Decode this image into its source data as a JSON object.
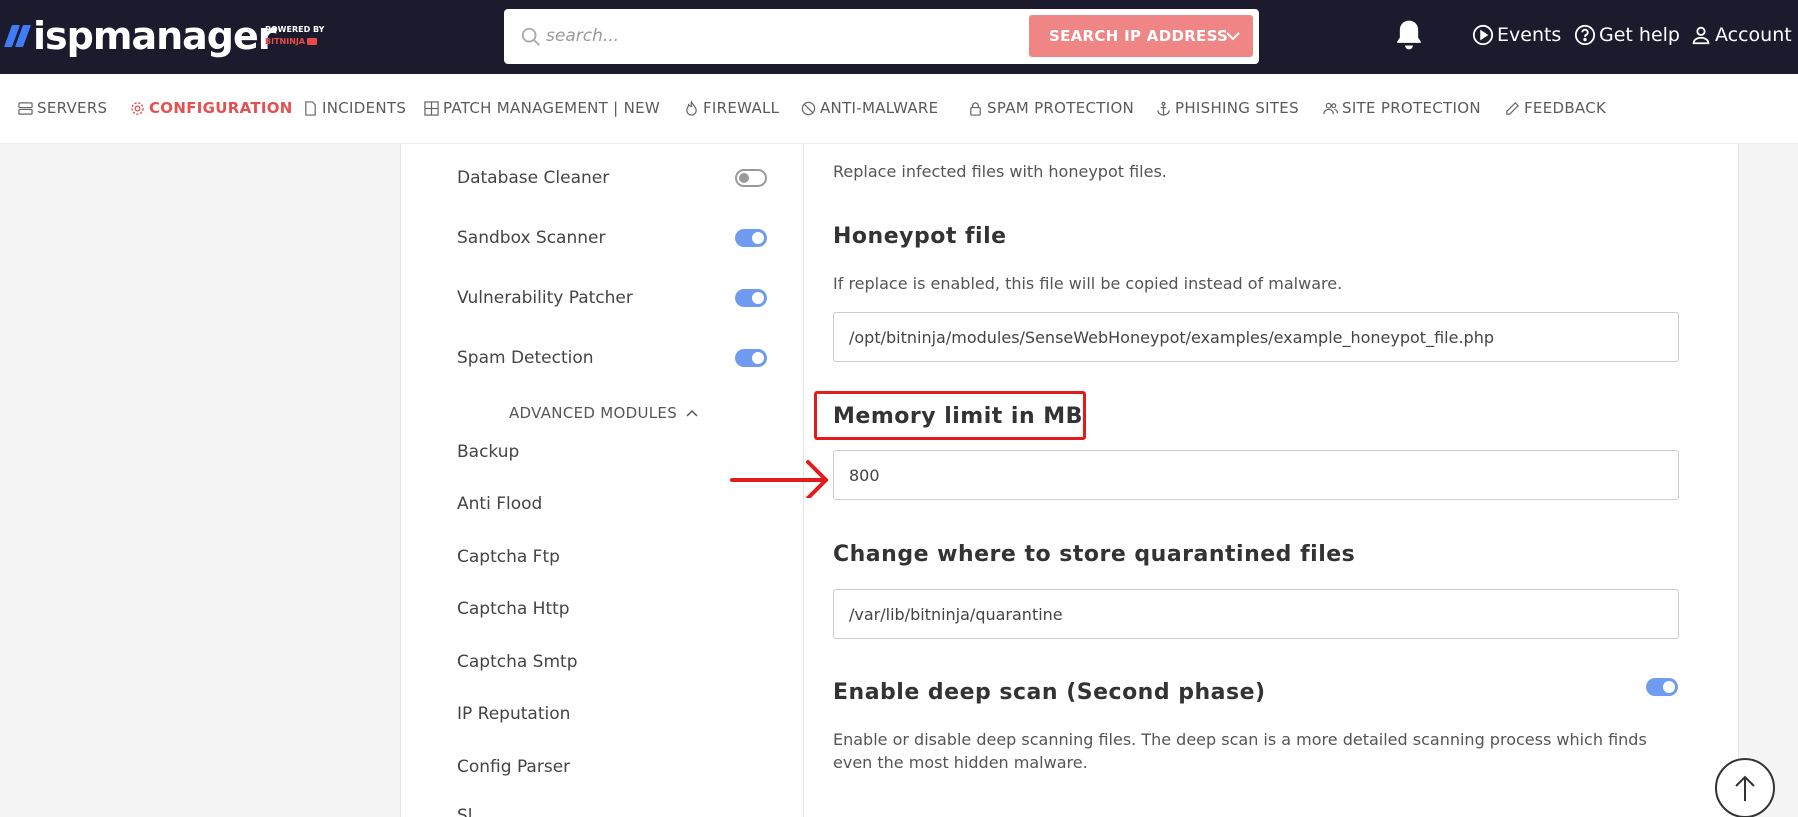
{
  "header": {
    "logo_text": "ispmanager",
    "powered_by": "POWERED BY",
    "powered_brand": "BITNINJA",
    "search_placeholder": "search...",
    "search_button": "SEARCH IP ADDRESS",
    "links": [
      {
        "label": "Events",
        "icon": "play-circle-icon"
      },
      {
        "label": "Get help",
        "icon": "question-circle-icon"
      },
      {
        "label": "Account",
        "icon": "user-icon"
      }
    ]
  },
  "nav": {
    "items": [
      {
        "label": "SERVERS",
        "icon": "server-icon"
      },
      {
        "label": "CONFIGURATION",
        "icon": "gear-icon"
      },
      {
        "label": "INCIDENTS",
        "icon": "document-icon"
      },
      {
        "label": "PATCH MANAGEMENT | NEW",
        "icon": "grid-icon"
      },
      {
        "label": "FIREWALL",
        "icon": "fire-icon"
      },
      {
        "label": "ANTI-MALWARE",
        "icon": "no-bug-icon"
      },
      {
        "label": "SPAM PROTECTION",
        "icon": "lock-icon"
      },
      {
        "label": "PHISHING SITES",
        "icon": "anchor-icon"
      },
      {
        "label": "SITE PROTECTION",
        "icon": "users-icon"
      },
      {
        "label": "FEEDBACK",
        "icon": "pencil-icon"
      }
    ]
  },
  "modules": [
    {
      "label": "Database Cleaner",
      "enabled": false
    },
    {
      "label": "Sandbox Scanner",
      "enabled": true
    },
    {
      "label": "Vulnerability Patcher",
      "enabled": true
    },
    {
      "label": "Spam Detection",
      "enabled": true
    }
  ],
  "advanced": {
    "label": "ADVANCED MODULES",
    "items": [
      "Backup",
      "Anti Flood",
      "Captcha Ftp",
      "Captcha Http",
      "Captcha Smtp",
      "IP Reputation",
      "Config Parser",
      "Sl..."
    ]
  },
  "settings": {
    "replace_desc": "Replace infected files with honeypot files.",
    "honeypot_title": "Honeypot file",
    "honeypot_desc": "If replace is enabled, this file will be copied instead of malware.",
    "honeypot_value": "/opt/bitninja/modules/SenseWebHoneypot/examples/example_honeypot_file.php",
    "memory_title": "Memory limit in MB",
    "memory_value": "800",
    "quarantine_title": "Change where to store quarantined files",
    "quarantine_value": "/var/lib/bitninja/quarantine",
    "deep_title": "Enable deep scan (Second phase)",
    "deep_enabled": true,
    "deep_desc": "Enable or disable deep scanning files. The deep scan is a more detailed scanning process which finds even the most hidden malware."
  },
  "colors": {
    "header_bg": "#1c1b2e",
    "accent": "#e55050",
    "toggle_on": "#6f9cf0",
    "annotation": "#e31b1b"
  }
}
